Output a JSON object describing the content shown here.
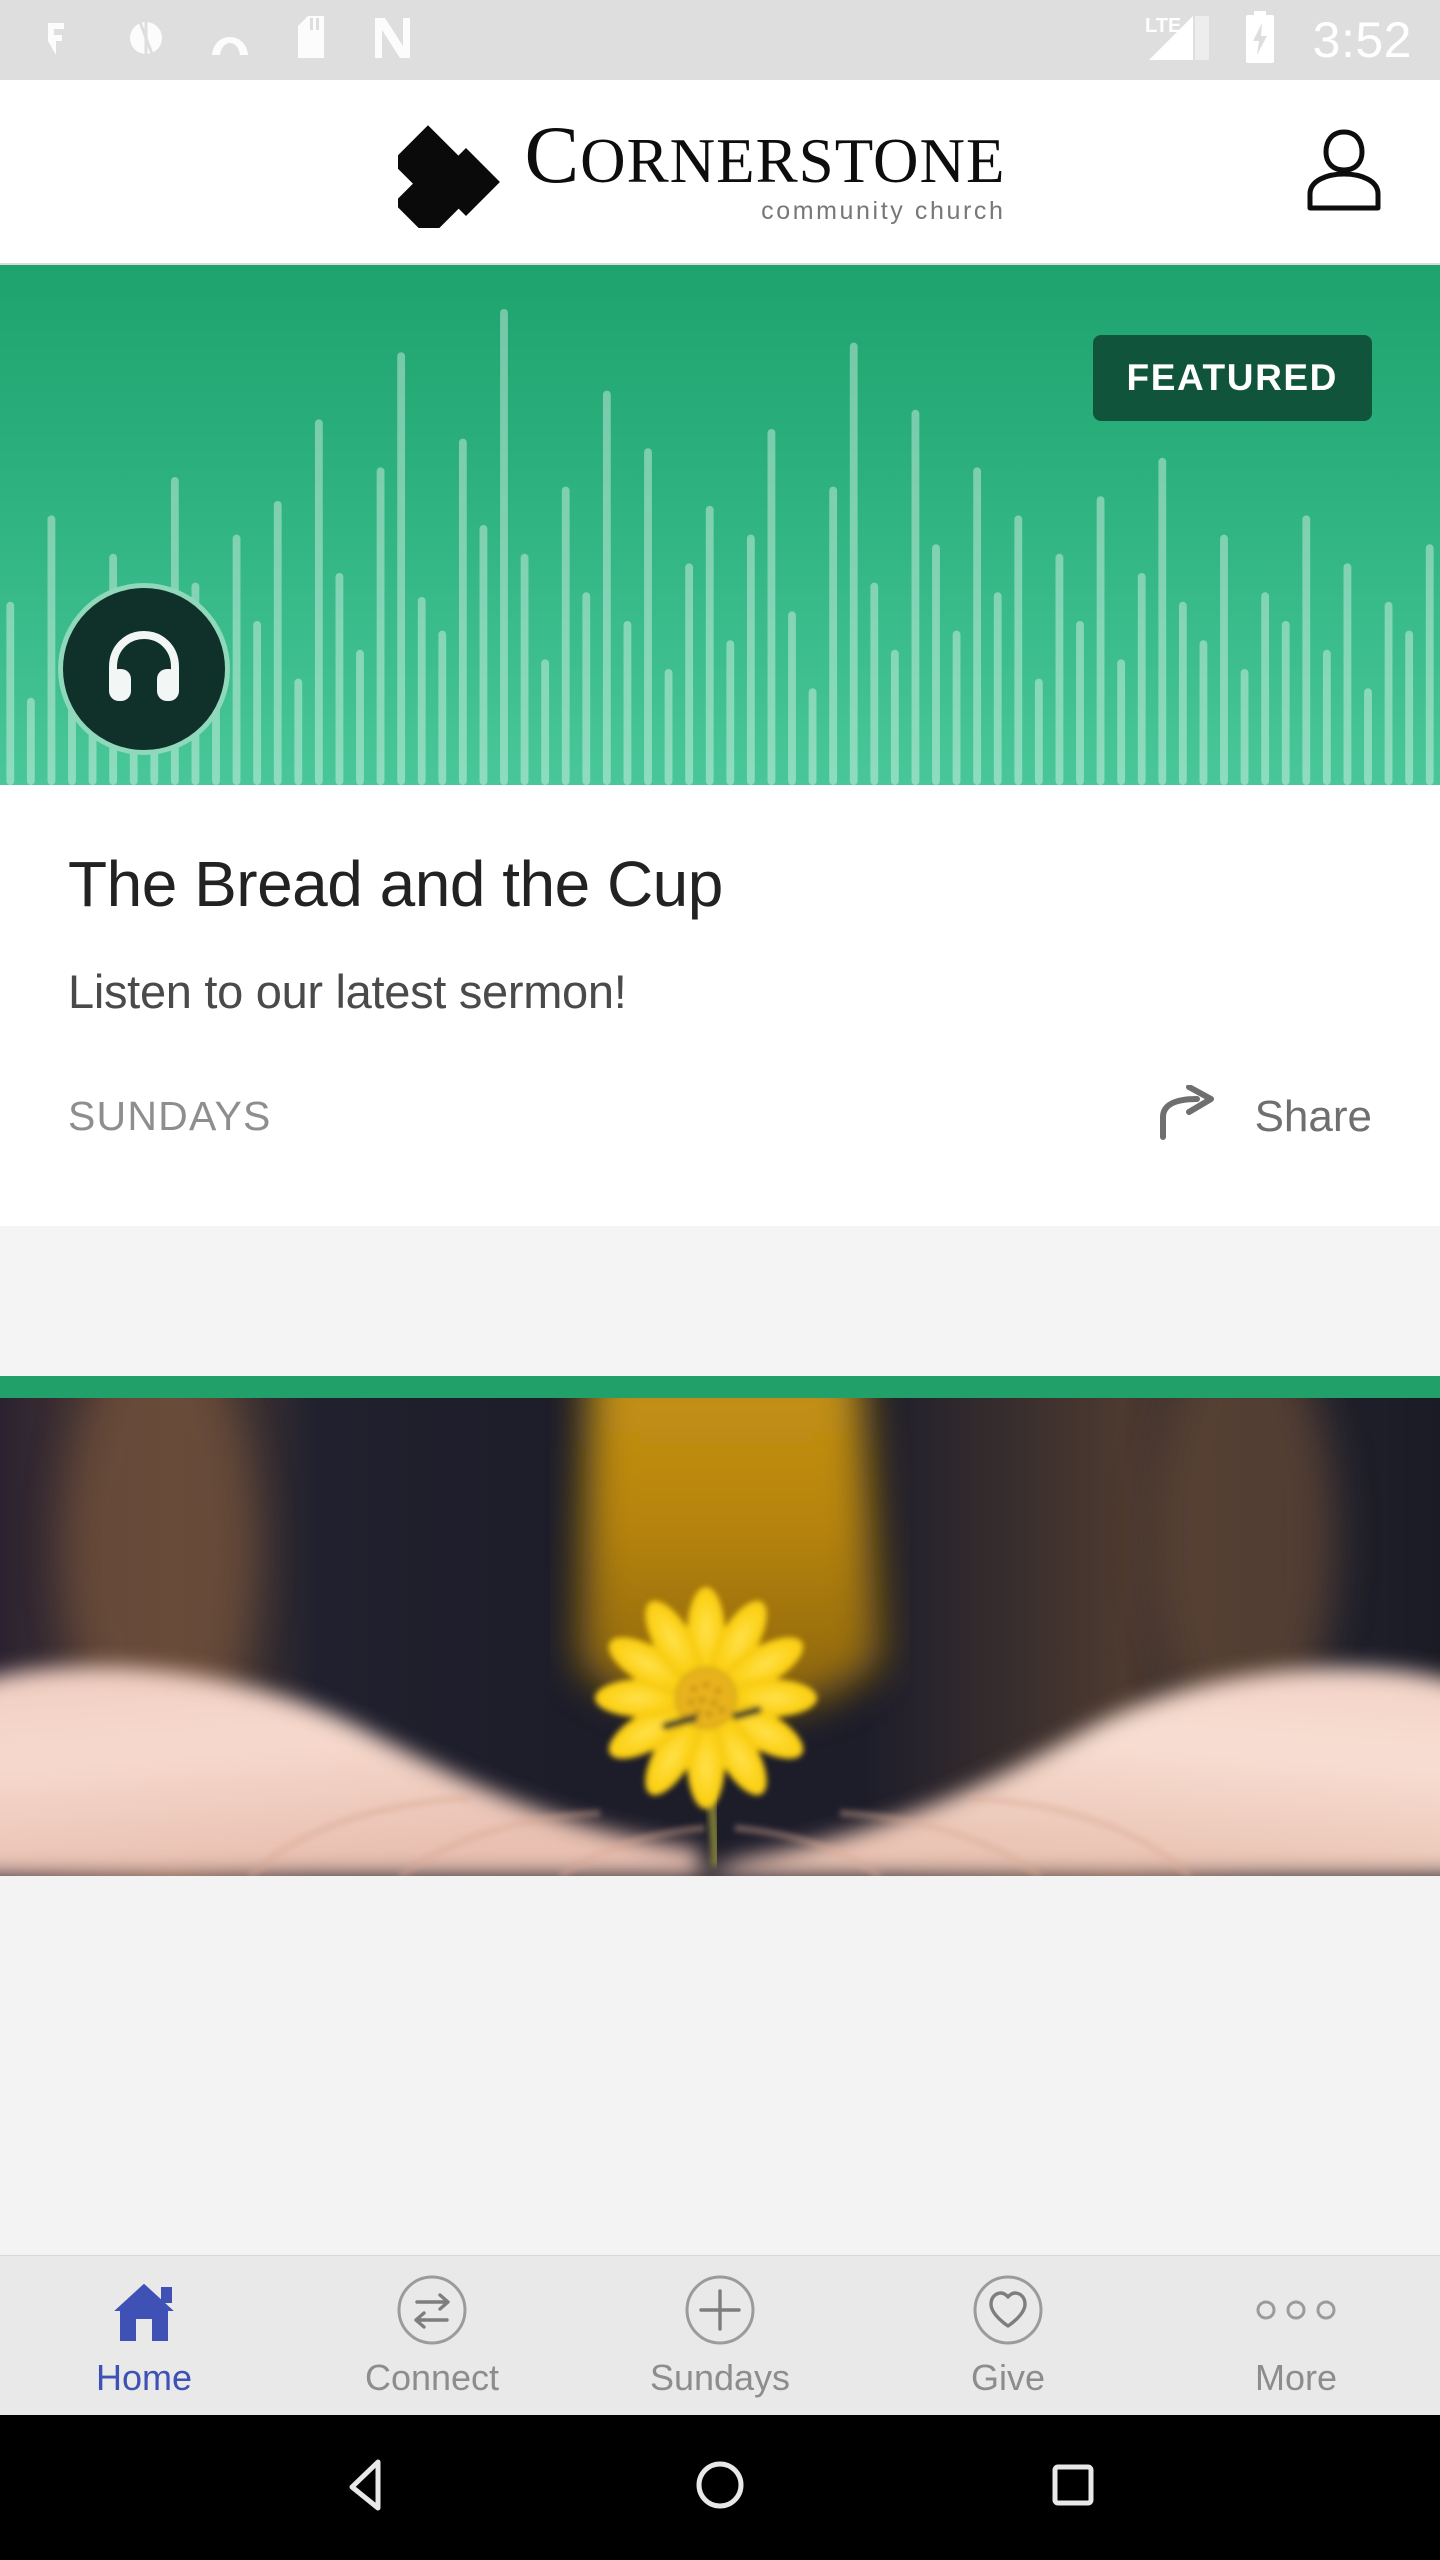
{
  "status_bar": {
    "icons": [
      "vf-icon",
      "wifi-calling-icon",
      "curve-icon",
      "sd-card-icon",
      "n-app-icon"
    ],
    "network_label": "LTE",
    "battery_state": "charging",
    "time": "3:52"
  },
  "header": {
    "logo_primary": "CORNERSTONE",
    "logo_primary_first": "C",
    "logo_primary_rest": "ORNERSTONE",
    "logo_secondary": "community church",
    "logo_mark": "three-diamonds-icon",
    "account_icon": "account-person-icon"
  },
  "featured_card": {
    "badge": "FEATURED",
    "media_icon": "headphones-icon",
    "title": "The Bread and the Cup",
    "subtitle": "Listen to our latest sermon!",
    "category": "SUNDAYS",
    "share_label": "Share",
    "share_icon": "share-arrow-icon",
    "hero_gradient_top": "#1ea36d",
    "hero_gradient_bottom": "#49c79a",
    "badge_color": "#11543c"
  },
  "photo_card": {
    "accent_strip_color": "#22a069",
    "image_alt": "hands-holding-yellow-flower"
  },
  "tabs": [
    {
      "label": "Home",
      "icon": "home-icon",
      "active": true
    },
    {
      "label": "Connect",
      "icon": "connect-exchange-icon",
      "active": false
    },
    {
      "label": "Sundays",
      "icon": "plus-circle-icon",
      "active": false
    },
    {
      "label": "Give",
      "icon": "heart-circle-icon",
      "active": false
    },
    {
      "label": "More",
      "icon": "three-dots-icon",
      "active": false
    }
  ],
  "tab_active_color": "#3f51b5",
  "tab_inactive_color": "#8d8d8d",
  "android_nav": {
    "back": "back-triangle-icon",
    "home": "home-circle-icon",
    "recents": "recents-square-icon"
  },
  "waveform": {
    "bars": [
      34,
      14,
      52,
      22,
      30,
      44,
      12,
      26,
      60,
      38,
      20,
      48,
      30,
      55,
      18,
      72,
      40,
      24,
      62,
      86,
      35,
      28,
      68,
      50,
      95,
      44,
      22,
      58,
      36,
      78,
      30,
      66,
      20,
      42,
      54,
      26,
      48,
      70,
      32,
      16,
      58,
      88,
      38,
      24,
      74,
      46,
      28,
      62,
      36,
      52,
      18,
      44,
      30,
      56,
      22,
      40,
      64,
      34,
      26,
      48,
      20,
      36,
      30,
      52,
      24,
      42,
      16,
      34,
      28,
      46
    ]
  }
}
